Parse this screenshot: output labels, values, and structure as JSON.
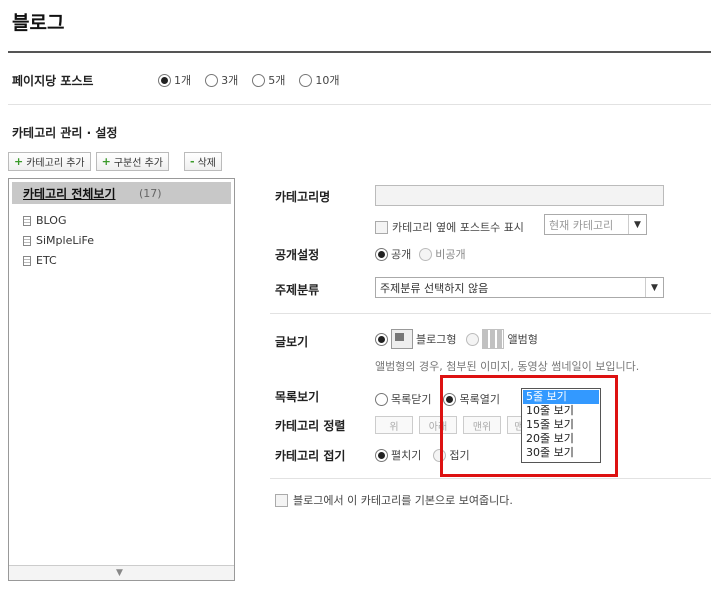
{
  "page_title": "블로그",
  "posts_per_page": {
    "label": "페이지당 포스트",
    "options": [
      "1개",
      "3개",
      "5개",
      "10개"
    ],
    "selected": "1개"
  },
  "category_section": {
    "title": "카테고리 관리 · 설정",
    "buttons": {
      "add_category": "카테고리 추가",
      "add_divider": "구분선 추가",
      "delete": "삭제"
    }
  },
  "tree": {
    "header_label": "카테고리 전체보기",
    "header_count": "(17)",
    "items": [
      {
        "label": "BLOG"
      },
      {
        "label": "SiMpleLiFe"
      },
      {
        "label": "ETC"
      }
    ]
  },
  "settings": {
    "category_name_label": "카테고리명",
    "category_name_value": "",
    "post_count_checkbox_label": "카테고리 옆에 포스트수 표시",
    "post_count_select": "현재 카테고리",
    "visibility_label": "공개설정",
    "visibility_options": [
      "공개",
      "비공개"
    ],
    "visibility_selected": "공개",
    "topic_label": "주제분류",
    "topic_select": "주제분류 선택하지 않음",
    "view_label": "글보기",
    "view_options": [
      "블로그형",
      "앨범형"
    ],
    "view_selected": "블로그형",
    "view_hint": "앨범형의 경우, 첨부된 이미지, 동영상 썸네일이 보입니다.",
    "list_view_label": "목록보기",
    "list_view_options": [
      "목록닫기",
      "목록열기"
    ],
    "list_view_selected": "목록열기",
    "list_rows_options": [
      "5줄 보기",
      "10줄 보기",
      "15줄 보기",
      "20줄 보기",
      "30줄 보기"
    ],
    "list_rows_selected": "5줄 보기",
    "sort_label": "카테고리 정렬",
    "sort_buttons": [
      "위",
      "아래",
      "맨위",
      "맨아래"
    ],
    "fold_label": "카테고리 접기",
    "fold_options": [
      "펼치기",
      "접기"
    ],
    "fold_selected": "펼치기",
    "default_checkbox_label": "블로그에서 이 카테고리를 기본으로 보여줍니다."
  },
  "colors": {
    "highlight_box": "#dd1111",
    "dropdown_selected": "#3399ff",
    "tree_header_bg": "#c8c8c8"
  }
}
